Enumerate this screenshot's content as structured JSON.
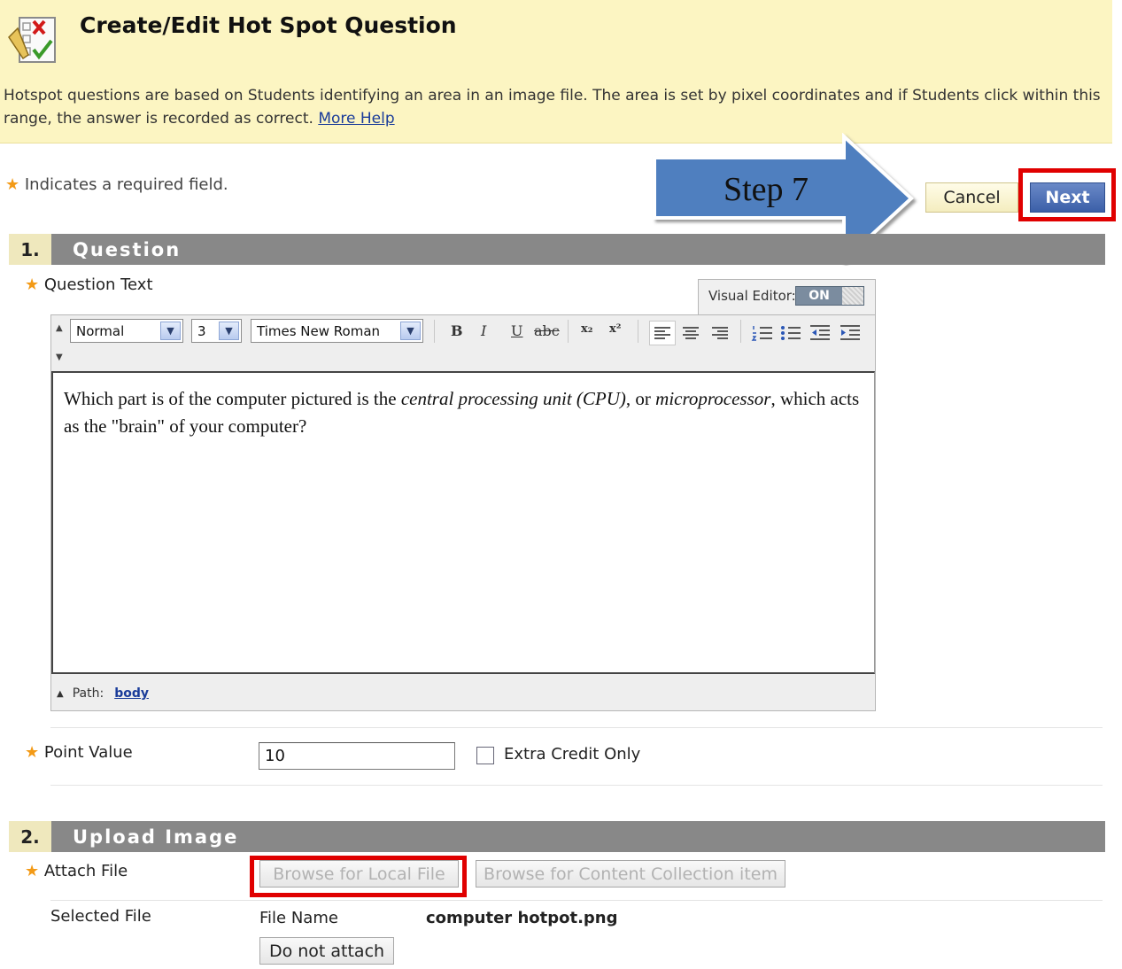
{
  "header": {
    "title": "Create/Edit Hot Spot Question",
    "instructions": "Hotspot questions are based on Students identifying an area in an image file. The area is set by pixel coordinates and if Students click within this range, the answer is recorded as correct.",
    "more_help": "More Help",
    "icon": "quiz-edit-icon"
  },
  "required_note": "Indicates a required field.",
  "annotation": {
    "step_label": "Step 7"
  },
  "top_buttons": {
    "cancel": "Cancel",
    "next": "Next"
  },
  "section1": {
    "number": "1.",
    "title": "Question",
    "question_text_label": "Question Text",
    "editor": {
      "visual_editor_label": "Visual Editor:",
      "visual_editor_state": "ON",
      "format": "Normal",
      "size": "3",
      "font": "Times New Roman",
      "toolbar": {
        "bold": "B",
        "italic": "I",
        "underline": "U",
        "strike": "abc",
        "subscript": "x₂",
        "superscript": "x²"
      },
      "content": {
        "p1": "Which part is of the computer pictured is the ",
        "italic1": "central processing unit (CPU)",
        "p2": ", or ",
        "italic2": "microprocessor",
        "p3": ", which acts as the \"brain\" of your computer?"
      },
      "path_label": "Path:",
      "path_value": "body"
    },
    "point_value_label": "Point Value",
    "point_value": "10",
    "extra_credit_label": "Extra Credit Only"
  },
  "section2": {
    "number": "2.",
    "title": "Upload Image",
    "attach_file_label": "Attach File",
    "browse_local": "Browse for Local File",
    "browse_collection": "Browse for Content Collection item",
    "selected_file_label": "Selected File",
    "file_name_label": "File Name",
    "file_name": "computer hotpot.png",
    "do_not_attach": "Do not attach"
  },
  "colors": {
    "header_bg": "#fcf5c2",
    "section_bar": "#888888",
    "highlight": "#e00000",
    "arrow_fill": "#4f7fbf",
    "next_button": "#3b5fa8",
    "required_star": "#f39a16"
  }
}
